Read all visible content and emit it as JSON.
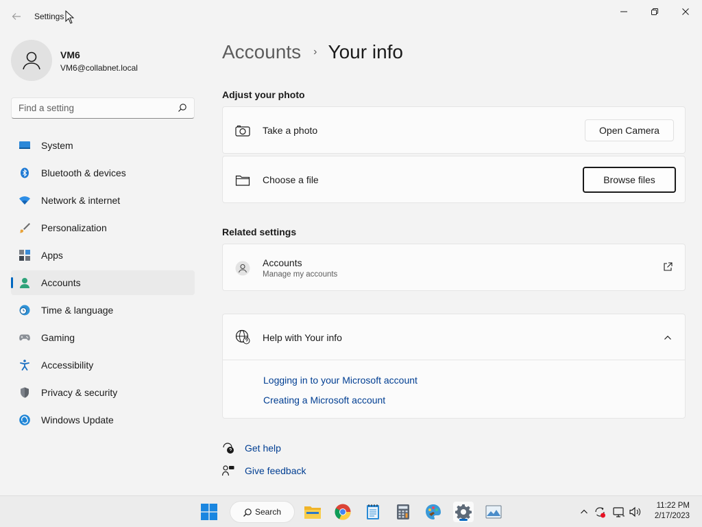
{
  "window": {
    "title": "Settings"
  },
  "profile": {
    "name": "VM6",
    "email": "VM6@collabnet.local"
  },
  "search": {
    "placeholder": "Find a setting"
  },
  "sidebar": {
    "items": [
      {
        "label": "System",
        "icon": "monitor-icon",
        "active": false
      },
      {
        "label": "Bluetooth & devices",
        "icon": "bluetooth-icon",
        "active": false
      },
      {
        "label": "Network & internet",
        "icon": "wifi-icon",
        "active": false
      },
      {
        "label": "Personalization",
        "icon": "brush-icon",
        "active": false
      },
      {
        "label": "Apps",
        "icon": "apps-icon",
        "active": false
      },
      {
        "label": "Accounts",
        "icon": "person-icon",
        "active": true
      },
      {
        "label": "Time & language",
        "icon": "globe-clock-icon",
        "active": false
      },
      {
        "label": "Gaming",
        "icon": "controller-icon",
        "active": false
      },
      {
        "label": "Accessibility",
        "icon": "accessibility-icon",
        "active": false
      },
      {
        "label": "Privacy & security",
        "icon": "shield-icon",
        "active": false
      },
      {
        "label": "Windows Update",
        "icon": "update-icon",
        "active": false
      }
    ]
  },
  "breadcrumb": {
    "parent": "Accounts",
    "separator": "›",
    "current": "Your info"
  },
  "adjust_photo": {
    "title": "Adjust your photo",
    "take_photo_label": "Take a photo",
    "open_camera_label": "Open Camera",
    "choose_file_label": "Choose a file",
    "browse_files_label": "Browse files"
  },
  "related": {
    "title": "Related settings",
    "accounts_label": "Accounts",
    "accounts_sub": "Manage my accounts"
  },
  "help": {
    "title": "Help with Your info",
    "links": [
      "Logging in to your Microsoft account",
      "Creating a Microsoft account"
    ]
  },
  "footer": {
    "get_help": "Get help",
    "give_feedback": "Give feedback"
  },
  "taskbar": {
    "search_label": "Search",
    "time": "11:22 PM",
    "date": "2/17/2023"
  },
  "colors": {
    "accent": "#0067c0",
    "link": "#003e92",
    "background": "#f3f3f3",
    "card": "#fbfbfb"
  }
}
